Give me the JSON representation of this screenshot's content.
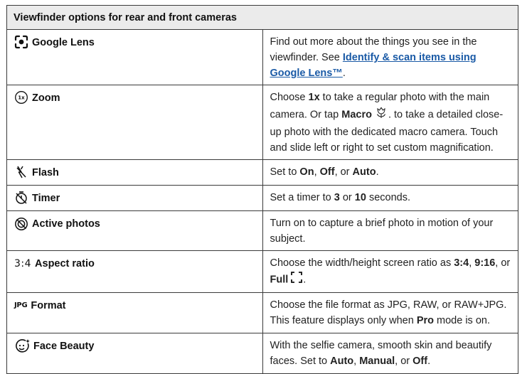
{
  "table": {
    "title": "Viewfinder options for rear and front cameras",
    "rows": [
      {
        "name": "Google Lens",
        "icon": "google-lens-icon",
        "desc_pre": "Find out more about the things you see in the viewfinder. See ",
        "link": "Identify & scan items using Google Lens™",
        "desc_post": "."
      },
      {
        "name": "Zoom",
        "icon": "zoom-1x-icon",
        "p1": "Choose ",
        "b1": "1x",
        "p2": " to take a regular photo with the main camera. Or tap ",
        "b2": "Macro",
        "p3": ". to take a detailed close-up photo with the dedicated macro camera. Touch and slide left or right to set custom magnification.",
        "inline_icon": "macro-flower-icon",
        "icon_label": "1x"
      },
      {
        "name": "Flash",
        "icon": "flash-off-icon",
        "p1": "Set to ",
        "b1": "On",
        "p2": ", ",
        "b2": "Off",
        "p3": ", or ",
        "b3": "Auto",
        "p4": "."
      },
      {
        "name": "Timer",
        "icon": "timer-off-icon",
        "p1": "Set a timer to ",
        "b1": "3",
        "p2": " or ",
        "b2": "10",
        "p3": " seconds."
      },
      {
        "name": "Active photos",
        "icon": "active-photos-off-icon",
        "desc": "Turn on to capture a brief photo in motion of your subject."
      },
      {
        "name": "Aspect ratio",
        "icon_text": "3:4",
        "p1": "Choose the width/height screen ratio as ",
        "b1": "3:4",
        "p2": ", ",
        "b2": "9:16",
        "p3": ", or ",
        "b3": "Full",
        "p4": ".",
        "inline_icon": "full-frame-icon"
      },
      {
        "name": "Format",
        "icon_text": "JPG",
        "p1": "Choose the file format as JPG, RAW, or RAW+JPG. This feature displays only when ",
        "b1": "Pro",
        "p2": " mode is on."
      },
      {
        "name": "Face Beauty",
        "icon": "face-beauty-icon",
        "p1": "With the selfie camera, smooth skin and beautify faces. Set to ",
        "b1": "Auto",
        "p2": ", ",
        "b2": "Manual",
        "p3": ", or ",
        "b3": "Off",
        "p4": "."
      }
    ]
  }
}
